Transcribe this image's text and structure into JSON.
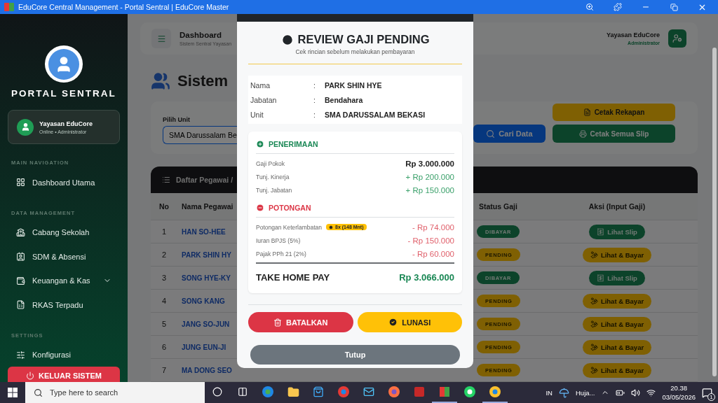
{
  "window": {
    "title": "EduCore Central Management - Portal Sentral | EduCore Master"
  },
  "sidebar": {
    "brand": "PORTAL SENTRAL",
    "user": {
      "name": "Yayasan EduCore",
      "status": "Online • Administrator"
    },
    "sections": [
      {
        "title": "MAIN NAVIGATION",
        "items": [
          {
            "label": "Dashboard Utama",
            "has_submenu": false
          }
        ]
      },
      {
        "title": "DATA MANAGEMENT",
        "items": [
          {
            "label": "Cabang Sekolah",
            "has_submenu": false
          },
          {
            "label": "SDM & Absensi",
            "has_submenu": false
          },
          {
            "label": "Keuangan & Kas",
            "has_submenu": true
          },
          {
            "label": "RKAS Terpadu",
            "has_submenu": false
          }
        ]
      },
      {
        "title": "SETTINGS",
        "items": [
          {
            "label": "Konfigurasi",
            "has_submenu": false
          }
        ]
      }
    ],
    "logout": "KELUAR SISTEM"
  },
  "header": {
    "title": "Dashboard",
    "subtitle": "Sistem Sentral Yayasan",
    "user_name": "Yayasan EduCore",
    "user_role": "Administrator"
  },
  "page_title": "Sistem",
  "filter": {
    "label": "Pilih Unit",
    "value": "SMA Darussalam Be",
    "search_button": "Cari Data",
    "recap_button": "Cetak Rekapan",
    "print_all_button": "Cetak Semua Slip"
  },
  "table": {
    "title": "Daftar Pegawai /",
    "columns": [
      "No",
      "Nama Pegawai",
      "Status Gaji",
      "Aksi (Input Gaji)"
    ],
    "rows": [
      {
        "no": "1",
        "name": "HAN SO-HEE",
        "status": {
          "label": "DIBAYAR",
          "kind": "paid"
        },
        "action": {
          "label": "Lihat Slip",
          "kind": "slip"
        }
      },
      {
        "no": "2",
        "name": "PARK SHIN HY",
        "status": {
          "label": "PENDING",
          "kind": "pending"
        },
        "action": {
          "label": "Lihat & Bayar",
          "kind": "pay"
        }
      },
      {
        "no": "3",
        "name": "SONG HYE-KY",
        "status": {
          "label": "DIBAYAR",
          "kind": "paid"
        },
        "action": {
          "label": "Lihat Slip",
          "kind": "slip"
        }
      },
      {
        "no": "4",
        "name": "SONG KANG",
        "status": {
          "label": "PENDING",
          "kind": "pending"
        },
        "action": {
          "label": "Lihat & Bayar",
          "kind": "pay"
        }
      },
      {
        "no": "5",
        "name": "JANG SO-JUN",
        "status": {
          "label": "PENDING",
          "kind": "pending"
        },
        "action": {
          "label": "Lihat & Bayar",
          "kind": "pay"
        }
      },
      {
        "no": "6",
        "name": "JUNG EUN-JI",
        "status": {
          "label": "PENDING",
          "kind": "pending"
        },
        "action": {
          "label": "Lihat & Bayar",
          "kind": "pay"
        }
      },
      {
        "no": "7",
        "name": "MA DONG SEO",
        "status": {
          "label": "PENDING",
          "kind": "pending"
        },
        "action": {
          "label": "Lihat & Bayar",
          "kind": "pay"
        }
      }
    ]
  },
  "modal": {
    "title": "REVIEW GAJI PENDING",
    "subtitle": "Cek rincian sebelum melakukan pembayaran",
    "info": [
      {
        "label": "Nama",
        "separator": ":",
        "value": "PARK SHIN HYE"
      },
      {
        "label": "Jabatan",
        "separator": ":",
        "value": "Bendahara"
      },
      {
        "label": "Unit",
        "separator": ":",
        "value": "SMA DARUSSALAM BEKASI"
      }
    ],
    "income": {
      "title": "PENERIMAAN",
      "rows": [
        {
          "label": "Gaji Pokok",
          "amount": "Rp 3.000.000",
          "kind": "base"
        },
        {
          "label": "Tunj. Kinerja",
          "amount": "+ Rp 200.000",
          "kind": "plus"
        },
        {
          "label": "Tunj. Jabatan",
          "amount": "+ Rp 150.000",
          "kind": "plus"
        }
      ]
    },
    "deductions": {
      "title": "POTONGAN",
      "rows": [
        {
          "label": "Potongan Keterlambatan",
          "badge": "8x (148 Mnt)",
          "amount": "- Rp 74.000"
        },
        {
          "label": "Iuran BPJS (5%)",
          "amount": "- Rp 150.000"
        },
        {
          "label": "Pajak PPh 21 (2%)",
          "amount": "- Rp 60.000"
        }
      ]
    },
    "total": {
      "label": "TAKE HOME PAY",
      "amount": "Rp 3.066.000"
    },
    "cancel_button": "BATALKAN",
    "pay_button": "LUNASI",
    "close_button": "Tutup"
  },
  "taskbar": {
    "search_placeholder": "Type here to search",
    "language": "IN",
    "weather": "Huja...",
    "time": "20.38",
    "date": "03/05/2026",
    "notifications": "1"
  }
}
